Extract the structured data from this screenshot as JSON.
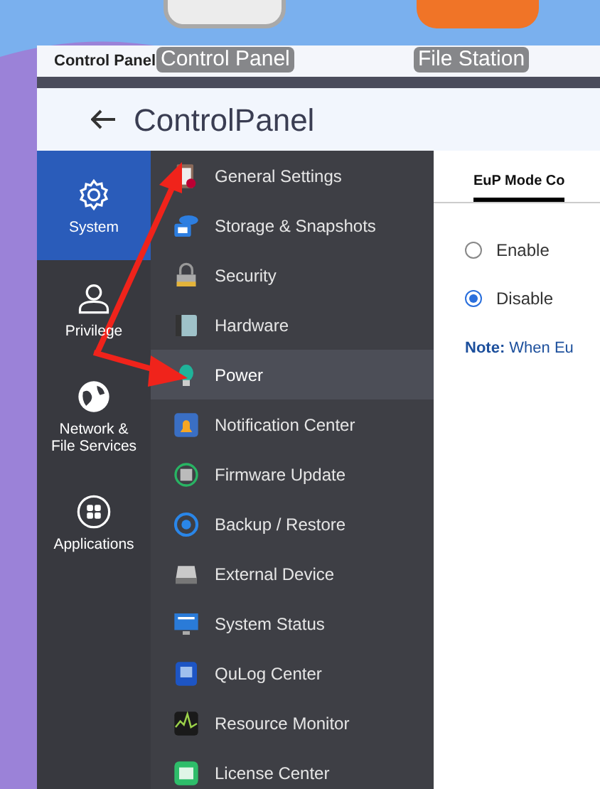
{
  "desktop": {
    "icon_labels": [
      "Control Panel",
      "File Station"
    ]
  },
  "window": {
    "title": "Control Panel",
    "header": "**Control**Panel"
  },
  "nav": [
    {
      "label": "System",
      "selected": true
    },
    {
      "label": "Privilege",
      "selected": false
    },
    {
      "label": "Network &\nFile Services",
      "selected": false
    },
    {
      "label": "Applications",
      "selected": false
    }
  ],
  "menu": [
    {
      "label": "General Settings",
      "selected": false
    },
    {
      "label": "Storage & Snapshots",
      "selected": false
    },
    {
      "label": "Security",
      "selected": false
    },
    {
      "label": "Hardware",
      "selected": false
    },
    {
      "label": "Power",
      "selected": true
    },
    {
      "label": "Notification Center",
      "selected": false
    },
    {
      "label": "Firmware Update",
      "selected": false
    },
    {
      "label": "Backup / Restore",
      "selected": false
    },
    {
      "label": "External Device",
      "selected": false
    },
    {
      "label": "System Status",
      "selected": false
    },
    {
      "label": "QuLog Center",
      "selected": false
    },
    {
      "label": "Resource Monitor",
      "selected": false
    },
    {
      "label": "License Center",
      "selected": false
    }
  ],
  "content": {
    "tabs": [
      {
        "label": "EuP Mode Co",
        "selected": true
      }
    ],
    "options": [
      {
        "label": "Enable",
        "selected": false
      },
      {
        "label": "Disable",
        "selected": true
      }
    ],
    "note": "**Note:** When Eu"
  }
}
